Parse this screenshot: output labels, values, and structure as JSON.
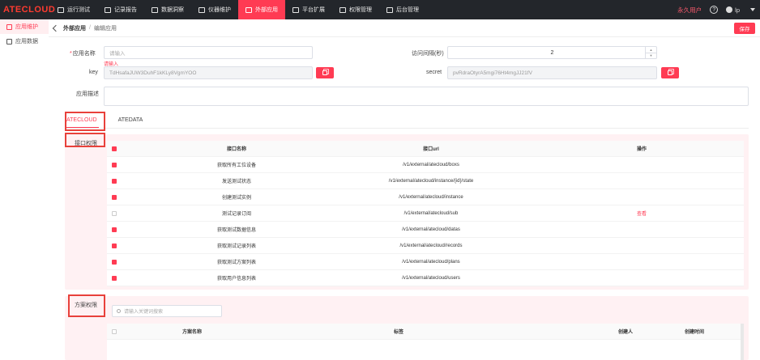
{
  "app": {
    "logo": "ATECLOUD"
  },
  "nav": [
    {
      "label": "运行测试",
      "icon": "monitor-icon"
    },
    {
      "label": "记录报告",
      "icon": "report-icon"
    },
    {
      "label": "数据洞察",
      "icon": "insight-icon"
    },
    {
      "label": "仪器维护",
      "icon": "instrument-icon"
    },
    {
      "label": "外部应用",
      "icon": "grid-icon"
    },
    {
      "label": "平台扩展",
      "icon": "extension-icon"
    },
    {
      "label": "权限管理",
      "icon": "permission-icon"
    },
    {
      "label": "后台管理",
      "icon": "admin-icon"
    }
  ],
  "topright": {
    "vip": "永久用户",
    "help": "?",
    "user": "lp"
  },
  "sidebar": [
    {
      "label": "应用维护"
    },
    {
      "label": "应用数据"
    }
  ],
  "breadcrumb": {
    "parent": "外部应用",
    "sep": "/",
    "current": "编辑应用"
  },
  "toolbar": {
    "save_label": "保存"
  },
  "form": {
    "name_label": "应用名称",
    "name_placeholder": "请输入",
    "name_error": "请输入",
    "interval_label": "访问间隔(秒)",
    "interval_value": "2",
    "key_label": "key",
    "key_value": "TdHsafaJUW3DuhF1kKLy8VgmYOO",
    "secret_label": "secret",
    "secret_value": "pvRdraOtyrA5mgi76Ht4mgJJ21fV",
    "desc_label": "应用描述"
  },
  "tabs": [
    {
      "label": "ATECLOUD"
    },
    {
      "label": "ATEDATA"
    }
  ],
  "api_section": {
    "title": "接口权限",
    "columns": {
      "name": "接口名称",
      "url": "接口url",
      "op": "操作"
    },
    "rows": [
      {
        "checked": true,
        "name": "获取所有工位设备",
        "url": "/v1/external/atecloud/boxs",
        "op": ""
      },
      {
        "checked": true,
        "name": "发送测试状态",
        "url": "/v1/external/atecloud/instance/{id}/state",
        "op": ""
      },
      {
        "checked": true,
        "name": "创建测试实例",
        "url": "/v1/external/atecloud/instance",
        "op": ""
      },
      {
        "checked": false,
        "name": "测试记录订阅",
        "url": "/v1/external/atecloud/sub",
        "op": "查看"
      },
      {
        "checked": true,
        "name": "获取测试数据信息",
        "url": "/v1/external/atecloud/datas",
        "op": ""
      },
      {
        "checked": true,
        "name": "获取测试记录列表",
        "url": "/v1/external/atecloud/records",
        "op": ""
      },
      {
        "checked": true,
        "name": "获取测试方案列表",
        "url": "/v1/external/atecloud/plans",
        "op": ""
      },
      {
        "checked": true,
        "name": "获取用户信息列表",
        "url": "/v1/external/atecloud/users",
        "op": ""
      }
    ]
  },
  "plan_section": {
    "title": "方案权限",
    "search_placeholder": "请输入关键词搜索",
    "columns": {
      "name": "方案名称",
      "tag": "标签",
      "creator": "创建人",
      "created": "创建时间"
    }
  },
  "colors": {
    "accent": "#ff3b53",
    "nav_bg": "#23262b",
    "highlight_box": "#e8413b"
  }
}
